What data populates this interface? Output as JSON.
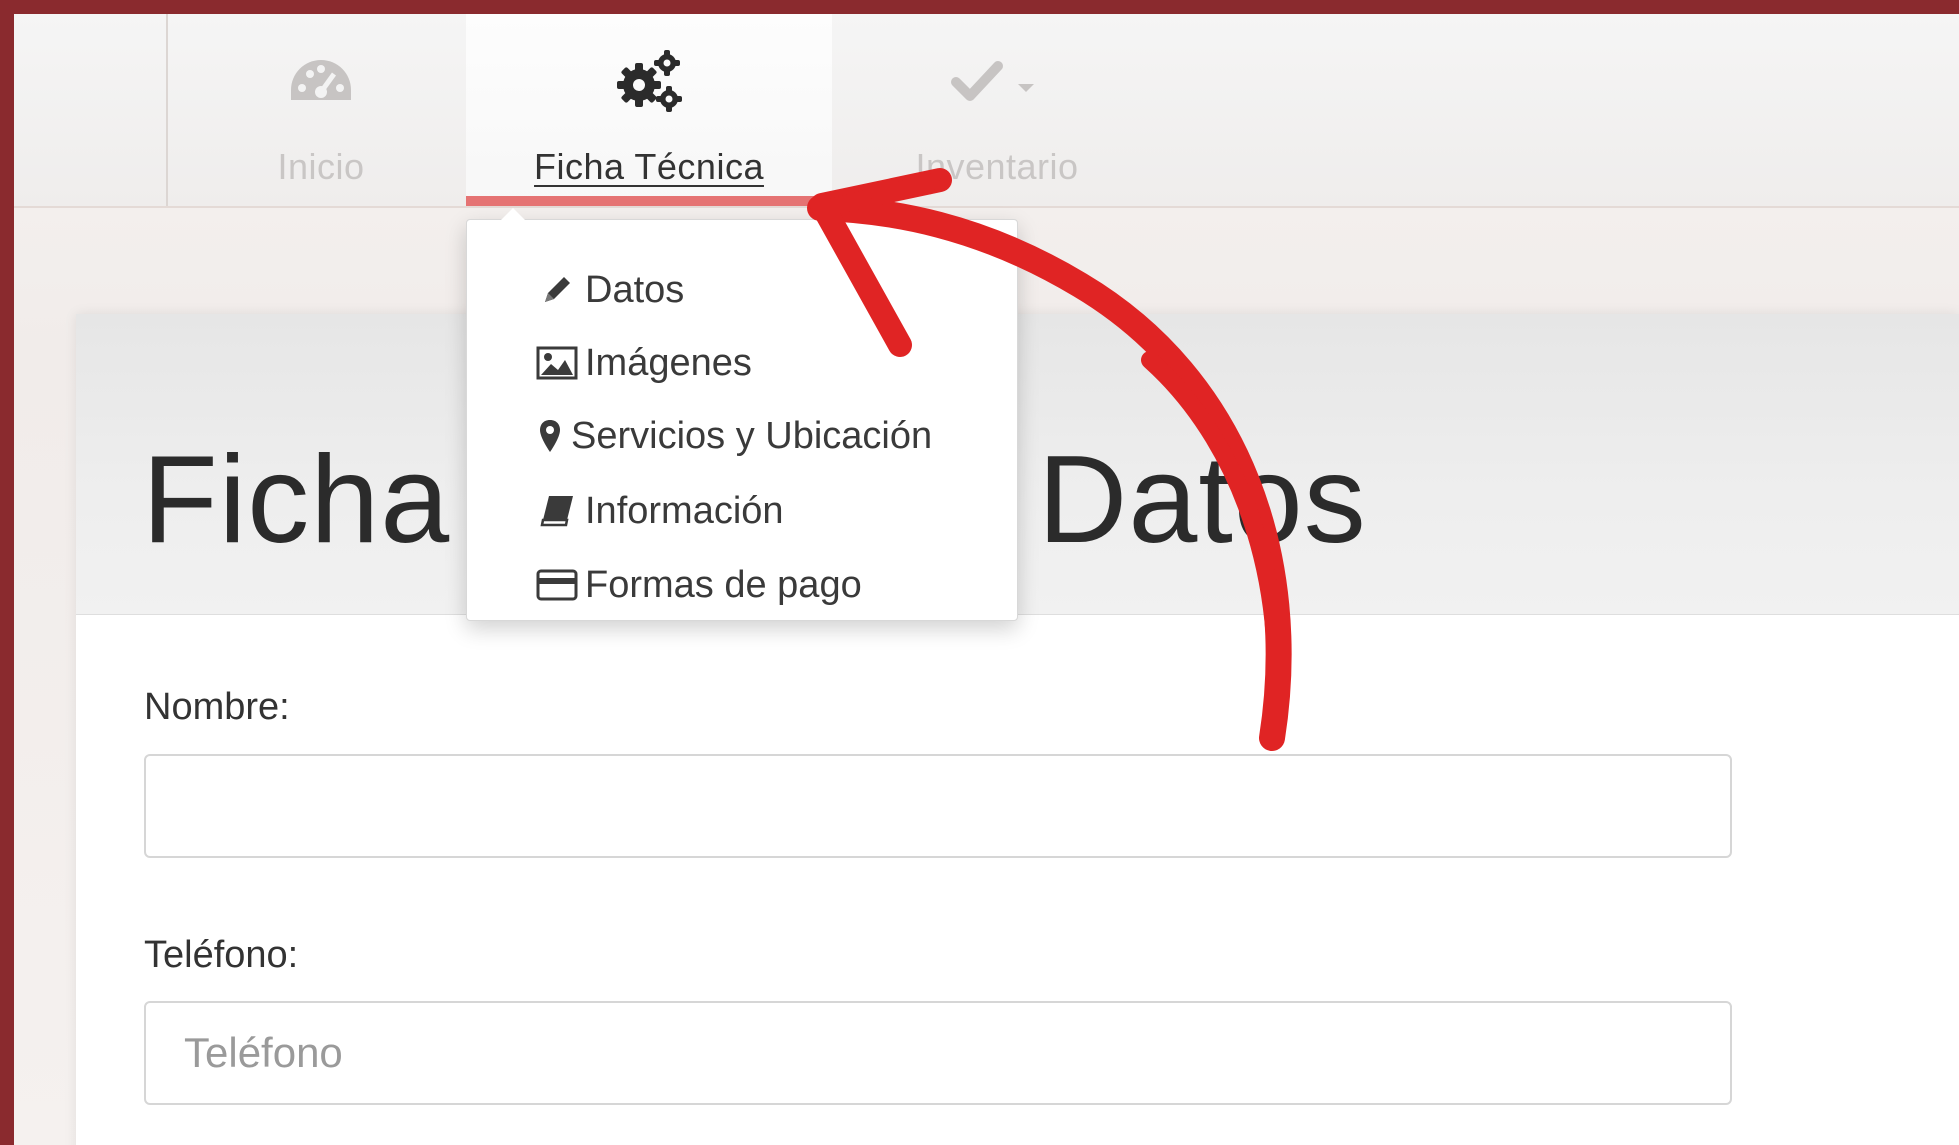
{
  "nav": {
    "items": [
      {
        "label": "Inicio",
        "icon": "dashboard-icon"
      },
      {
        "label": "Ficha Técnica",
        "icon": "gears-icon"
      },
      {
        "label": "Inventario",
        "icon": "check-icon"
      }
    ]
  },
  "dropdown": {
    "items": [
      {
        "label": "Datos",
        "icon": "pencil-icon"
      },
      {
        "label": "Imágenes",
        "icon": "image-icon"
      },
      {
        "label": "Servicios y Ubicación",
        "icon": "map-marker-icon"
      },
      {
        "label": "Información",
        "icon": "book-icon"
      },
      {
        "label": "Formas de pago",
        "icon": "credit-card-icon"
      }
    ]
  },
  "page": {
    "title": "Ficha Técnica - Datos"
  },
  "form": {
    "nombre_label": "Nombre:",
    "nombre_value": "",
    "telefono_label": "Teléfono:",
    "telefono_placeholder": "Teléfono"
  },
  "colors": {
    "frame": "#8a2a2e",
    "active_underline": "#e57373",
    "annotation_arrow": "#e02424"
  }
}
